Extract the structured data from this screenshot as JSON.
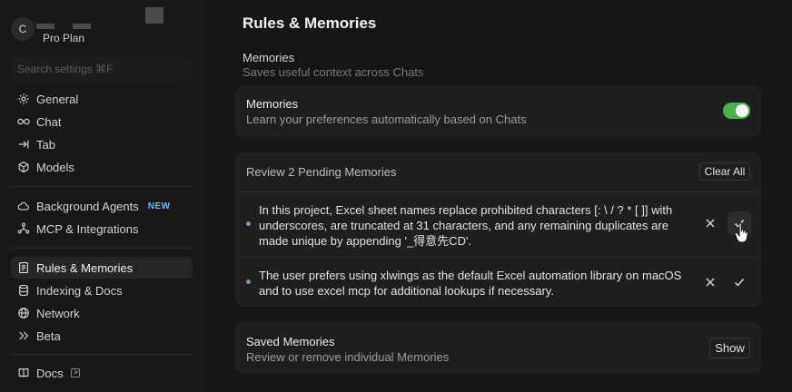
{
  "sidebar": {
    "avatar_initial": "C",
    "plan": "Pro Plan",
    "search_placeholder": "Search settings ⌘F",
    "items": [
      {
        "label": "General",
        "icon": "gear-icon"
      },
      {
        "label": "Chat",
        "icon": "infinity-icon"
      },
      {
        "label": "Tab",
        "icon": "tab-arrow-icon"
      },
      {
        "label": "Models",
        "icon": "cube-icon"
      },
      {
        "label": "Background Agents",
        "icon": "cloud-icon",
        "badge": "NEW"
      },
      {
        "label": "MCP & Integrations",
        "icon": "network-nodes-icon"
      },
      {
        "label": "Rules & Memories",
        "icon": "document-icon",
        "active": true
      },
      {
        "label": "Indexing & Docs",
        "icon": "database-icon"
      },
      {
        "label": "Network",
        "icon": "globe-icon"
      },
      {
        "label": "Beta",
        "icon": "chevrons-right-icon"
      },
      {
        "label": "Docs",
        "icon": "book-icon"
      }
    ]
  },
  "main": {
    "title": "Rules & Memories",
    "section_title": "Memories",
    "section_subtitle": "Saves useful context across Chats",
    "memories_card": {
      "title": "Memories",
      "subtitle": "Learn your preferences automatically based on Chats",
      "enabled": true
    },
    "pending": {
      "header": "Review 2 Pending Memories",
      "clear_all": "Clear All",
      "items": [
        {
          "text": "In this project, Excel sheet names replace prohibited characters [: \\ / ? * [ ]] with underscores, are truncated at 31 characters, and any remaining duplicates are made unique by appending '_得意先CD'."
        },
        {
          "text": "The user prefers using xlwings as the default Excel automation library on macOS and to use excel mcp for additional lookups if necessary."
        }
      ]
    },
    "saved": {
      "title": "Saved Memories",
      "subtitle": "Review or remove individual Memories",
      "button": "Show"
    }
  },
  "colors": {
    "background": "#161616",
    "card": "#1f1f1f",
    "toggle_on": "#4caf50",
    "badge_new": "#79b8ff"
  }
}
